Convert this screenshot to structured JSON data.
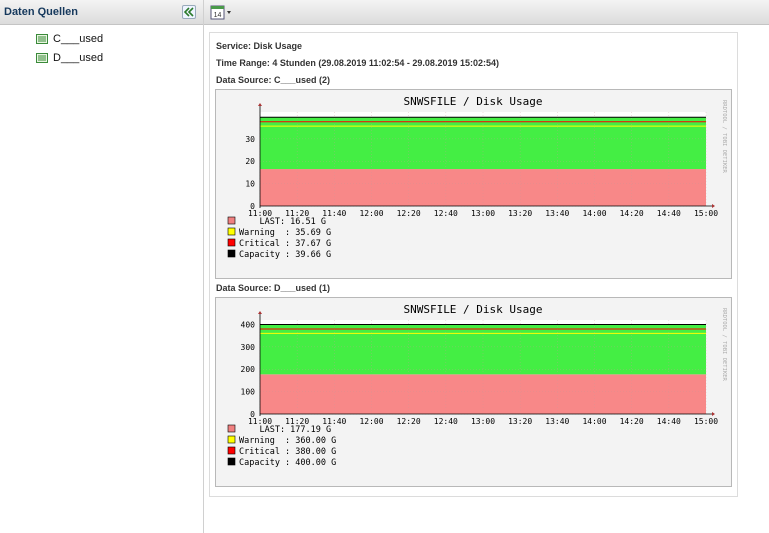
{
  "sidebar": {
    "title": "Daten Quellen",
    "items": [
      {
        "label": "C___used"
      },
      {
        "label": "D___used"
      }
    ]
  },
  "toolbar": {
    "calendar_day": "14"
  },
  "main": {
    "service": "Service: Disk Usage",
    "time_range": "Time Range: 4 Stunden (29.08.2019 11:02:54 - 29.08.2019 15:02:54)",
    "watermark": "RRDTOOL / TOBI OETIKER",
    "graphs": [
      {
        "source_label": "Data Source: C___used (2)",
        "chart_data": {
          "type": "area",
          "title": "SNWSFILE / Disk Usage",
          "x_ticks": [
            "11:00",
            "11:20",
            "11:40",
            "12:00",
            "12:20",
            "12:40",
            "13:00",
            "13:20",
            "13:40",
            "14:00",
            "14:20",
            "14:40",
            "15:00"
          ],
          "y_ticks": [
            0,
            10,
            20,
            30
          ],
          "ylim": [
            0,
            42
          ],
          "grid": true,
          "series": [
            {
              "name": "LAST",
              "value": 16.51,
              "color": "#f08080"
            },
            {
              "name": "Warning",
              "value": 35.69,
              "color": "#ffff00"
            },
            {
              "name": "Critical",
              "value": 37.67,
              "color": "#ff0000"
            },
            {
              "name": "Capacity",
              "value": 39.66,
              "color": "#000000"
            }
          ],
          "legend": [
            {
              "text": "    LAST: 16.51 G",
              "color": "#f08080"
            },
            {
              "text": "Warning  : 35.69 G",
              "color": "#ffff00"
            },
            {
              "text": "Critical : 37.67 G",
              "color": "#ff0000"
            },
            {
              "text": "Capacity : 39.66 G",
              "color": "#000000"
            }
          ],
          "colors": {
            "used": "#f88888",
            "free": "#44ee44"
          }
        }
      },
      {
        "source_label": "Data Source: D___used (1)",
        "chart_data": {
          "type": "area",
          "title": "SNWSFILE / Disk Usage",
          "x_ticks": [
            "11:00",
            "11:20",
            "11:40",
            "12:00",
            "12:20",
            "12:40",
            "13:00",
            "13:20",
            "13:40",
            "14:00",
            "14:20",
            "14:40",
            "15:00"
          ],
          "y_ticks": [
            0,
            100,
            200,
            300,
            400
          ],
          "ylim": [
            0,
            420
          ],
          "grid": true,
          "series": [
            {
              "name": "LAST",
              "value": 177.19,
              "color": "#f08080"
            },
            {
              "name": "Warning",
              "value": 360.0,
              "color": "#ffff00"
            },
            {
              "name": "Critical",
              "value": 380.0,
              "color": "#ff0000"
            },
            {
              "name": "Capacity",
              "value": 400.0,
              "color": "#000000"
            }
          ],
          "legend": [
            {
              "text": "    LAST: 177.19 G",
              "color": "#f08080"
            },
            {
              "text": "Warning  : 360.00 G",
              "color": "#ffff00"
            },
            {
              "text": "Critical : 380.00 G",
              "color": "#ff0000"
            },
            {
              "text": "Capacity : 400.00 G",
              "color": "#000000"
            }
          ],
          "colors": {
            "used": "#f88888",
            "free": "#44ee44"
          }
        }
      }
    ]
  }
}
